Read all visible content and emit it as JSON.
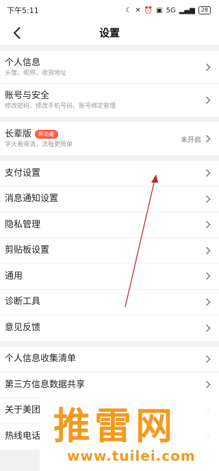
{
  "status": {
    "time": "下午5:11",
    "battery": "28",
    "network": "5G"
  },
  "nav": {
    "title": "设置"
  },
  "groups": [
    {
      "items": [
        {
          "title": "个人信息",
          "sub": "头像、昵称、收货地址"
        },
        {
          "title": "账号与安全",
          "sub": "修改密码、修改手机号码、账号绑定管理"
        }
      ]
    },
    {
      "items": [
        {
          "title": "长辈版",
          "badge": "新功能",
          "sub": "字大看得清，流程更简单",
          "right": "未开启"
        }
      ]
    },
    {
      "items": [
        {
          "title": "支付设置"
        },
        {
          "title": "消息通知设置"
        },
        {
          "title": "隐私管理"
        },
        {
          "title": "剪贴板设置"
        },
        {
          "title": "通用"
        },
        {
          "title": "诊断工具"
        },
        {
          "title": "意见反馈"
        }
      ]
    },
    {
      "items": [
        {
          "title": "个人信息收集清单"
        },
        {
          "title": "第三方信息数据共享"
        },
        {
          "title": "关于美团"
        },
        {
          "title": "热线电话"
        }
      ]
    }
  ],
  "watermark": {
    "text": "推雷网",
    "url": "www.tuilei.com"
  },
  "colors": {
    "accent": "#ff5a3c",
    "watermark": "#f39a1e",
    "annotation_arrow": "#c0282d"
  }
}
